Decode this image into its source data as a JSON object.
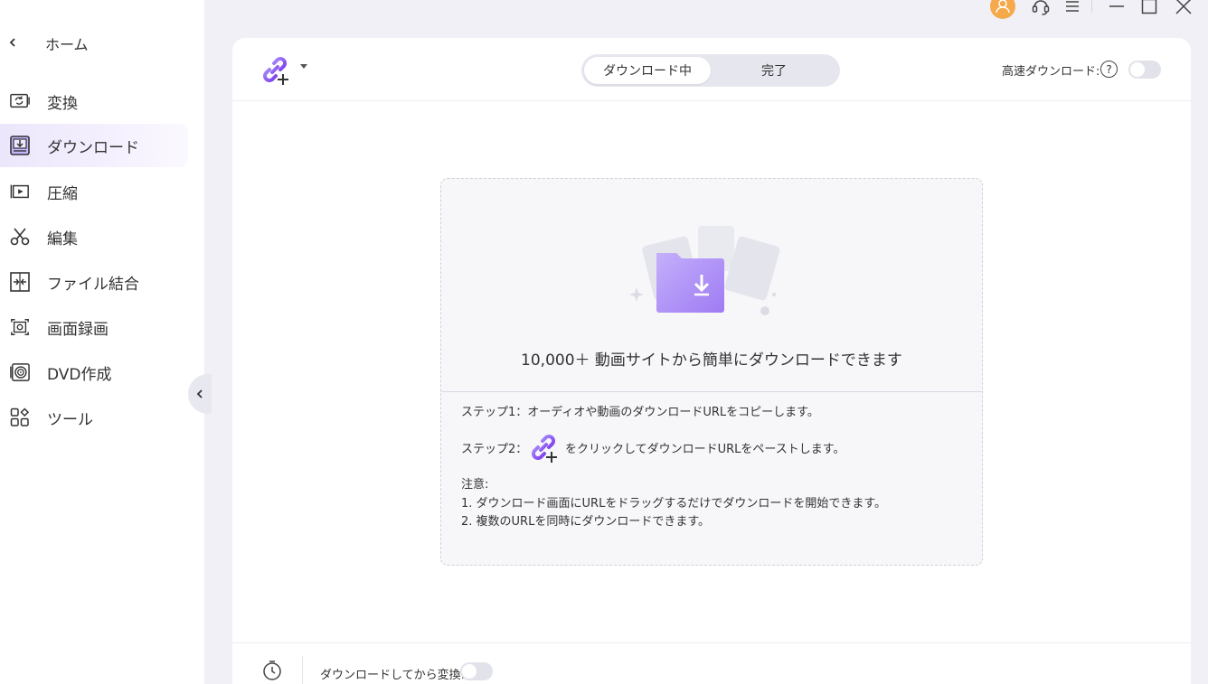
{
  "sidebar": {
    "home_label": "ホーム",
    "items": [
      {
        "label": "変換",
        "icon": "convert-icon"
      },
      {
        "label": "ダウンロード",
        "icon": "download-icon",
        "active": true
      },
      {
        "label": "圧縮",
        "icon": "compress-icon"
      },
      {
        "label": "編集",
        "icon": "scissors-icon"
      },
      {
        "label": "ファイル結合",
        "icon": "merge-icon"
      },
      {
        "label": "画面録画",
        "icon": "screen-record-icon"
      },
      {
        "label": "DVD作成",
        "icon": "dvd-icon"
      },
      {
        "label": "ツール",
        "icon": "toolbox-icon"
      }
    ]
  },
  "titlebar": {
    "icons": [
      "user-avatar-icon",
      "support-headset-icon",
      "menu-icon",
      "minimize-icon",
      "maximize-icon",
      "close-icon"
    ]
  },
  "header": {
    "tabs": [
      {
        "label": "ダウンロード中",
        "selected": true
      },
      {
        "label": "完了",
        "selected": false
      }
    ],
    "fast_download_label": "高速ダウンロード:",
    "help_glyph": "?",
    "fast_download_enabled": false
  },
  "dropzone": {
    "title": "10,000＋ 動画サイトから簡単にダウンロードできます",
    "step1": "ステップ1：オーディオや動画のダウンロードURLをコピーします。",
    "step2_prefix": "ステップ2：",
    "step2_suffix": "をクリックしてダウンロードURLをペーストします。",
    "note_title": "注意:",
    "note1": "1. ダウンロード画面にURLをドラッグするだけでダウンロードを開始できます。",
    "note2": "2. 複数のURLを同時にダウンロードできます。"
  },
  "footer": {
    "convert_after_label": "ダウンロードしてから変換:",
    "convert_after_enabled": false
  },
  "colors": {
    "accent": "#8b5cf6",
    "active_nav": "#ece6fc",
    "avatar": "#f5a94b"
  }
}
